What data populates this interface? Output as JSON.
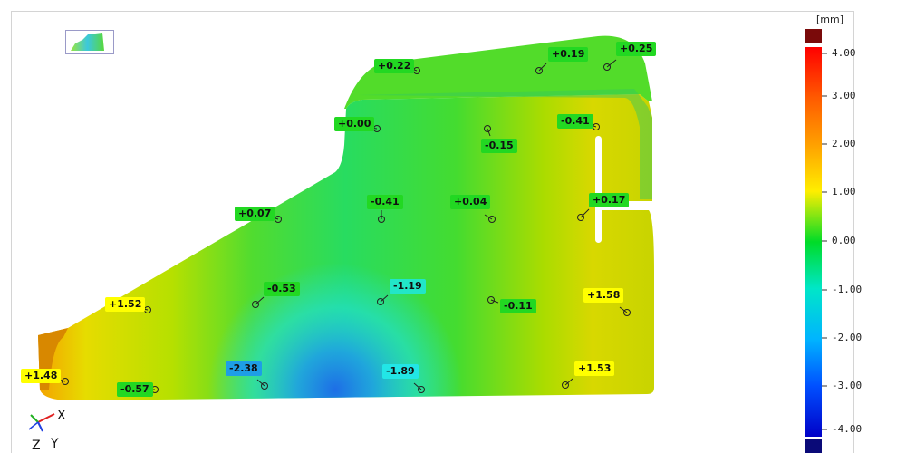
{
  "scale": {
    "unit": "[mm]",
    "ticks": [
      "4.00",
      "3.00",
      "2.00",
      "1.00",
      "0.00",
      "-1.00",
      "-2.00",
      "-3.00",
      "-4.00"
    ],
    "colors": {
      "over": "#7a0a0a",
      "under": "#0a0a78",
      "stops": [
        "#ff0000",
        "#ff7a00",
        "#ffe800",
        "#96e600",
        "#00dc28",
        "#00e6e6",
        "#0064ff",
        "#0000c8"
      ]
    }
  },
  "axes": {
    "x": "X",
    "y": "Y",
    "z": "Z"
  },
  "labels": [
    {
      "text": "+0.22",
      "color": "#22d822"
    },
    {
      "text": "+0.19",
      "color": "#22d822"
    },
    {
      "text": "+0.25",
      "color": "#22d822"
    },
    {
      "text": "+0.00",
      "color": "#22d822"
    },
    {
      "text": "-0.15",
      "color": "#22d822"
    },
    {
      "text": "-0.41",
      "color": "#22d822"
    },
    {
      "text": "+0.07",
      "color": "#22d822"
    },
    {
      "text": "-0.41",
      "color": "#22d822"
    },
    {
      "text": "+0.04",
      "color": "#22d822"
    },
    {
      "text": "+0.17",
      "color": "#22d822"
    },
    {
      "text": "+1.52",
      "color": "#ffff00"
    },
    {
      "text": "-0.53",
      "color": "#22d822"
    },
    {
      "text": "-1.19",
      "color": "#22e6c8"
    },
    {
      "text": "-0.11",
      "color": "#22d822"
    },
    {
      "text": "+1.58",
      "color": "#ffff00"
    },
    {
      "text": "+1.48",
      "color": "#ffff00"
    },
    {
      "text": "-0.57",
      "color": "#22d822"
    },
    {
      "text": "-2.38",
      "color": "#1e9ee6"
    },
    {
      "text": "-1.89",
      "color": "#22e6e6"
    },
    {
      "text": "+1.53",
      "color": "#ffff00"
    }
  ]
}
